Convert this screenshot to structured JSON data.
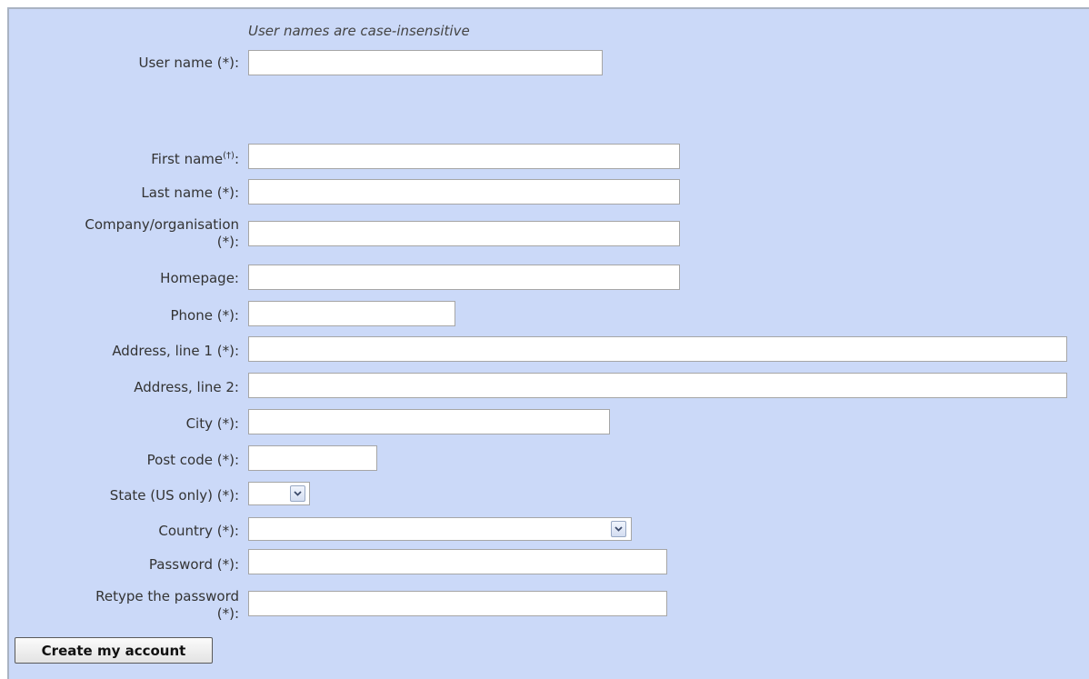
{
  "form": {
    "note": "User names are case-insensitive",
    "fields": {
      "username": {
        "label": "User name (*):",
        "value": ""
      },
      "first_name": {
        "label": "First name",
        "label_sup": "(†)",
        "label_suffix": ":",
        "value": ""
      },
      "last_name": {
        "label": "Last name (*):",
        "value": ""
      },
      "company": {
        "label_line1": "Company/organisation",
        "label_line2": "(*):",
        "value": ""
      },
      "homepage": {
        "label": "Homepage:",
        "value": ""
      },
      "phone": {
        "label": "Phone (*):",
        "value": ""
      },
      "address1": {
        "label": "Address, line 1 (*):",
        "value": ""
      },
      "address2": {
        "label": "Address, line 2:",
        "value": ""
      },
      "city": {
        "label": "City (*):",
        "value": ""
      },
      "postcode": {
        "label": "Post code (*):",
        "value": ""
      },
      "state": {
        "label": "State (US only) (*):",
        "selected": ""
      },
      "country": {
        "label": "Country (*):",
        "selected": ""
      },
      "password": {
        "label": "Password (*):",
        "value": ""
      },
      "password_retype": {
        "label_line1": "Retype the password",
        "label_line2": "(*):",
        "value": ""
      }
    },
    "submit_label": "Create my account"
  },
  "icons": {
    "dropdown": "chevron-down-icon"
  },
  "colors": {
    "panel_background": "#cbd9f8",
    "input_border": "#a6a6a6"
  }
}
